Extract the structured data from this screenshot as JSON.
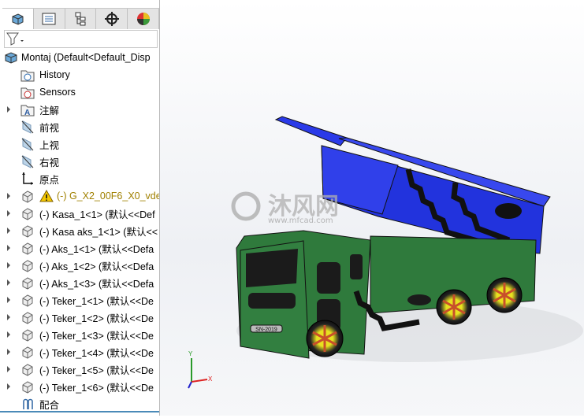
{
  "tabs": [
    {
      "name": "feature-manager",
      "icon": "assembly-icon",
      "active": true
    },
    {
      "name": "property-manager",
      "icon": "property-list-icon"
    },
    {
      "name": "configuration-manager",
      "icon": "configuration-tree-icon"
    },
    {
      "name": "dimxpert-manager",
      "icon": "crosshair-icon"
    },
    {
      "name": "display-manager",
      "icon": "color-wheel-icon"
    }
  ],
  "filter": {
    "icon": "filter-icon"
  },
  "tree": {
    "root": "Montaj  (Default<Default_Disp",
    "items": [
      {
        "label": "History",
        "icon": "history-folder-icon",
        "expand": false
      },
      {
        "label": "Sensors",
        "icon": "sensors-folder-icon",
        "expand": false
      },
      {
        "label": "注解",
        "icon": "annotations-folder-icon",
        "expand": true
      },
      {
        "label": "前视",
        "icon": "plane-icon",
        "expand": false
      },
      {
        "label": "上视",
        "icon": "plane-icon",
        "expand": false
      },
      {
        "label": "右视",
        "icon": "plane-icon",
        "expand": false
      },
      {
        "label": "原点",
        "icon": "origin-icon",
        "expand": false
      },
      {
        "label": "(-) G_X2_00F6_X0_vde.",
        "icon": "part-icon",
        "warning": true,
        "expand": true
      },
      {
        "label": "(-) Kasa_1<1> (默认<<Def",
        "icon": "part-icon",
        "expand": true
      },
      {
        "label": "(-) Kasa aks_1<1> (默认<<",
        "icon": "part-icon",
        "expand": true
      },
      {
        "label": "(-) Aks_1<1> (默认<<Defa",
        "icon": "part-icon",
        "expand": true
      },
      {
        "label": "(-) Aks_1<2> (默认<<Defa",
        "icon": "part-icon",
        "expand": true
      },
      {
        "label": "(-) Aks_1<3> (默认<<Defa",
        "icon": "part-icon",
        "expand": true
      },
      {
        "label": "(-) Teker_1<1> (默认<<De",
        "icon": "part-icon",
        "expand": true
      },
      {
        "label": "(-) Teker_1<2> (默认<<De",
        "icon": "part-icon",
        "expand": true
      },
      {
        "label": "(-) Teker_1<3> (默认<<De",
        "icon": "part-icon",
        "expand": true
      },
      {
        "label": "(-) Teker_1<4> (默认<<De",
        "icon": "part-icon",
        "expand": true
      },
      {
        "label": "(-) Teker_1<5> (默认<<De",
        "icon": "part-icon",
        "expand": true
      },
      {
        "label": "(-) Teker_1<6> (默认<<De",
        "icon": "part-icon",
        "expand": true
      },
      {
        "label": "配合",
        "icon": "mates-icon",
        "expand": false
      }
    ]
  },
  "watermark": {
    "brand": "沐风网",
    "url": "www.mfcad.com"
  },
  "model": {
    "bed_color": "#2233dd",
    "body_color": "#2f7a3c",
    "plate": "SN-2019"
  },
  "colors": {
    "warning": "#a08000",
    "accent": "#4a8ab8"
  }
}
